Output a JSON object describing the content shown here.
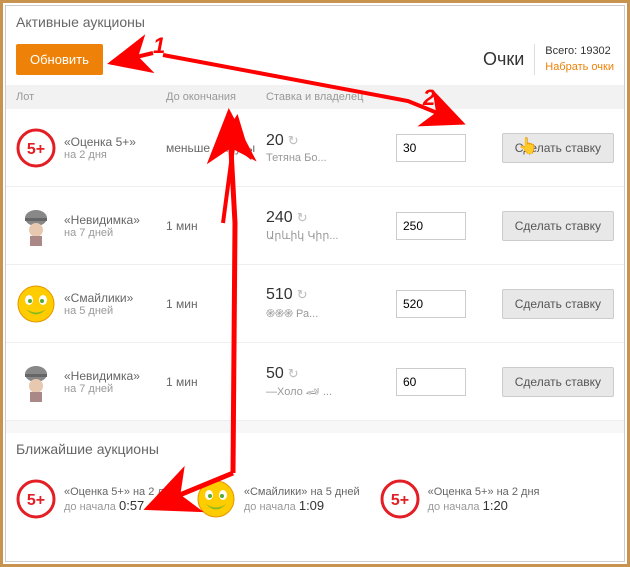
{
  "section_active": "Активные аукционы",
  "refresh_label": "Обновить",
  "points_label": "Очки",
  "points_total": "Всего: 19302",
  "points_earn": "Набрать очки",
  "headers": {
    "lot": "Лот",
    "time": "До окончания",
    "bid": "Ставка и владелец"
  },
  "bid_button": "Сделать ставку",
  "rows": [
    {
      "name": "«Оценка 5+»",
      "dur": "на 2 дня",
      "time": "меньше минуты",
      "amount": "20",
      "owner": "Тетяна Бо...",
      "input": "30",
      "icon": "five"
    },
    {
      "name": "«Невидимка»",
      "dur": "на 7 дней",
      "time": "1 мин",
      "amount": "240",
      "owner": "Արևիկ Կիր...",
      "input": "250",
      "icon": "ghost"
    },
    {
      "name": "«Смайлики»",
      "dur": "на 5 дней",
      "time": "1 мин",
      "amount": "510",
      "owner": "֍֍֍ Ра...",
      "input": "520",
      "icon": "smile"
    },
    {
      "name": "«Невидимка»",
      "dur": "на 7 дней",
      "time": "1 мин",
      "amount": "50",
      "owner": "—Холо 🏎 ...",
      "input": "60",
      "icon": "ghost"
    }
  ],
  "section_upcoming": "Ближайшие аукционы",
  "upcoming": [
    {
      "name": "«Оценка 5+» на 2 дня",
      "prefix": "до начала",
      "timer": "0:57",
      "icon": "five"
    },
    {
      "name": "«Смайлики» на 5 дней",
      "prefix": "до начала",
      "timer": "1:09",
      "icon": "smile"
    },
    {
      "name": "«Оценка 5+» на 2 дня",
      "prefix": "до начала",
      "timer": "1:20",
      "icon": "five"
    }
  ],
  "ann": {
    "n1": "1",
    "n2": "2"
  }
}
